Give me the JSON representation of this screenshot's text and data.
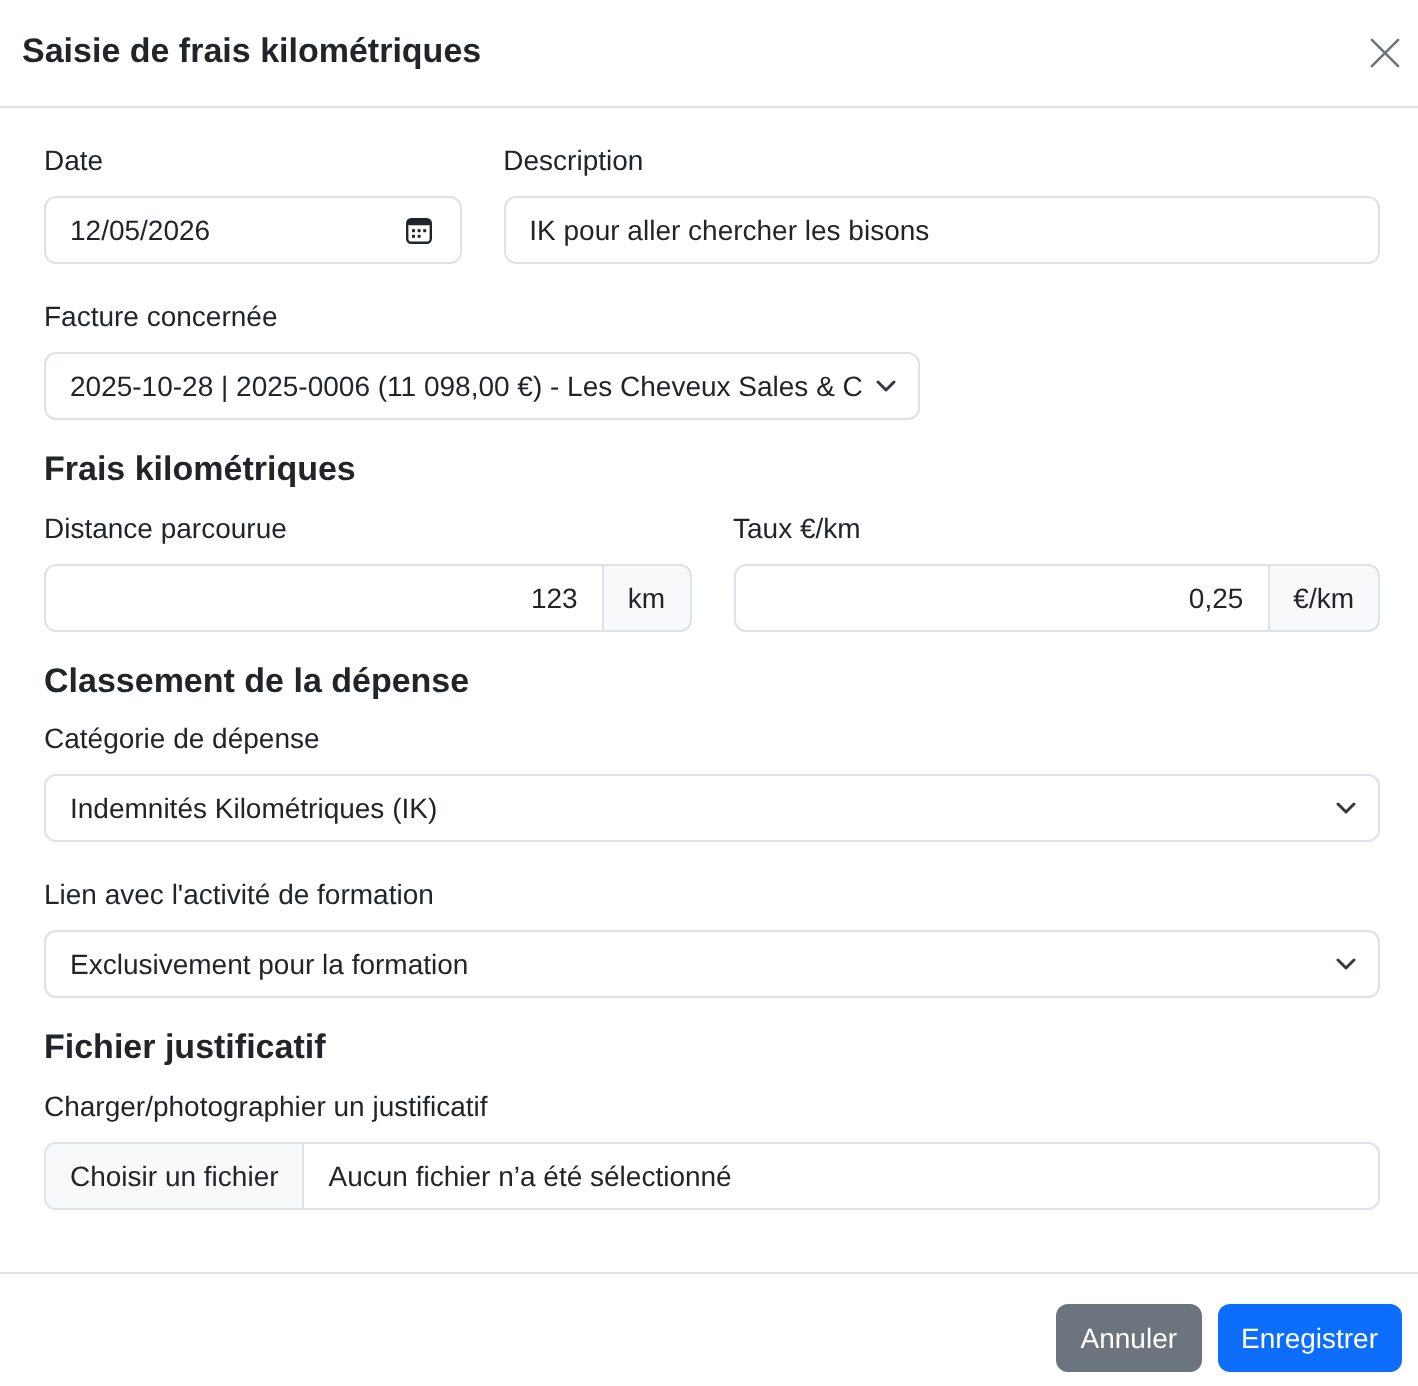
{
  "header": {
    "title": "Saisie de frais kilométriques"
  },
  "top_fields": [
    {
      "kind": "date",
      "label": "Date",
      "value": "12/05/2026"
    },
    {
      "kind": "text",
      "label": "Description",
      "value": "IK pour aller chercher les bisons"
    },
    {
      "kind": "select",
      "label": "Facture concernée",
      "value": "2025-10-28 | 2025-0006 (11 098,00 €) - Les Cheveux Sales & C"
    }
  ],
  "sections": [
    {
      "heading": "Frais kilométriques",
      "fields": [
        {
          "kind": "measure",
          "label": "Distance parcourue",
          "value": "123",
          "unit": "km"
        },
        {
          "kind": "measure",
          "label": "Taux €/km",
          "value": "0,25",
          "unit": "€/km"
        }
      ]
    },
    {
      "heading": "Classement de la dépense",
      "fields": [
        {
          "kind": "select",
          "label": "Catégorie de dépense",
          "value": "Indemnités Kilométriques (IK)"
        },
        {
          "kind": "select",
          "label": "Lien avec l'activité de formation",
          "value": "Exclusivement pour la formation"
        }
      ]
    },
    {
      "heading": "Fichier justificatif",
      "fields": [
        {
          "kind": "file",
          "label": "Charger/photographier un justificatif",
          "button": "Choisir un fichier",
          "value": "Aucun fichier n’a été sélectionné"
        }
      ]
    }
  ],
  "footer": {
    "buttons": [
      {
        "kind": "secondary",
        "label": "Annuler"
      },
      {
        "kind": "primary",
        "label": "Enregistrer"
      }
    ]
  }
}
